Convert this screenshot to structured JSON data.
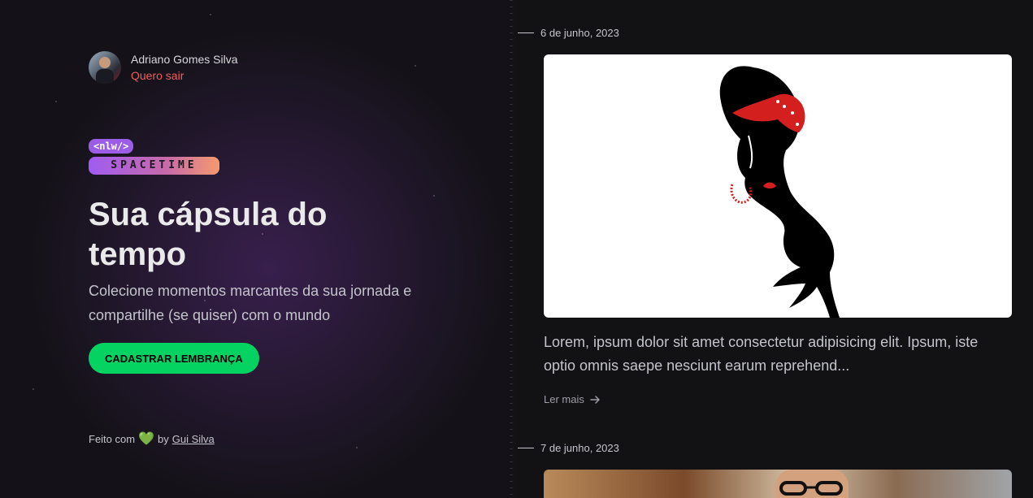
{
  "sidebar": {
    "user_name": "Adriano Gomes Silva",
    "logout_label": "Quero sair",
    "logo_top": "<nlw/>",
    "logo_bottom": "SPACETIME",
    "headline": "Sua cápsula do tempo",
    "subtitle": "Colecione momentos marcantes da sua jornada e compartilhe (se quiser) com o mundo",
    "cta_label": "CADASTRAR LEMBRANÇA",
    "footer_prefix": "Feito com",
    "footer_by": "by",
    "footer_author": "Gui Silva"
  },
  "timeline": {
    "memories": [
      {
        "date": "6 de junho, 2023",
        "excerpt": "Lorem, ipsum dolor sit amet consectetur adipisicing elit. Ipsum, iste optio omnis saepe nesciunt earum reprehend...",
        "read_more_label": "Ler mais"
      },
      {
        "date": "7 de junho, 2023"
      }
    ]
  },
  "colors": {
    "accent_green": "#04d361",
    "logout_red": "#ef5d5d",
    "brand_purple": "#9b5de5",
    "brand_orange": "#f59a6e"
  },
  "icons": [
    "heart-icon",
    "arrow-right-icon"
  ]
}
